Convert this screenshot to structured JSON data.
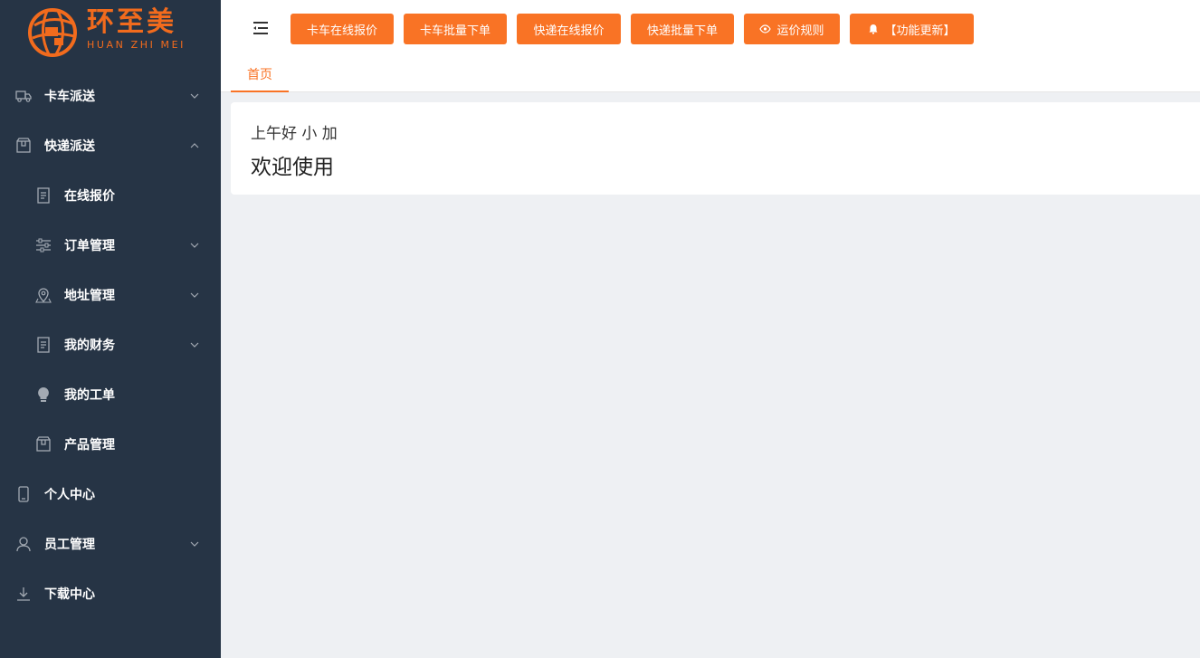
{
  "brand": {
    "name_cn": "环至美",
    "name_en": "HUAN ZHI MEI",
    "accent_color": "#f97325",
    "sidebar_color": "#263445"
  },
  "sidebar": {
    "items": [
      {
        "label": "卡车派送",
        "icon": "truck-icon",
        "has_arrow": true,
        "arrow": "down"
      },
      {
        "label": "快递派送",
        "icon": "package-icon",
        "has_arrow": true,
        "arrow": "up"
      },
      {
        "label": "在线报价",
        "icon": "document-icon",
        "has_arrow": false
      },
      {
        "label": "订单管理",
        "icon": "sliders-icon",
        "has_arrow": true,
        "arrow": "down"
      },
      {
        "label": "地址管理",
        "icon": "location-pin-icon",
        "has_arrow": true,
        "arrow": "down"
      },
      {
        "label": "我的财务",
        "icon": "document-icon",
        "has_arrow": true,
        "arrow": "down"
      },
      {
        "label": "我的工单",
        "icon": "lightbulb-icon",
        "has_arrow": false
      },
      {
        "label": "产品管理",
        "icon": "package-icon",
        "has_arrow": false
      },
      {
        "label": "个人中心",
        "icon": "mobile-icon",
        "has_arrow": false
      },
      {
        "label": "员工管理",
        "icon": "user-icon",
        "has_arrow": true,
        "arrow": "down"
      },
      {
        "label": "下载中心",
        "icon": "download-icon",
        "has_arrow": false
      }
    ]
  },
  "toolbar": {
    "buttons": [
      {
        "label": "卡车在线报价"
      },
      {
        "label": "卡车批量下单"
      },
      {
        "label": "快递在线报价"
      },
      {
        "label": "快递批量下单"
      },
      {
        "label": "运价规则",
        "icon": "eye-icon"
      },
      {
        "label": "【功能更新】",
        "icon": "bell-icon"
      }
    ]
  },
  "tabs": [
    {
      "label": "首页",
      "active": true
    }
  ],
  "main": {
    "greeting": "上午好 小 加",
    "welcome": "欢迎使用"
  }
}
